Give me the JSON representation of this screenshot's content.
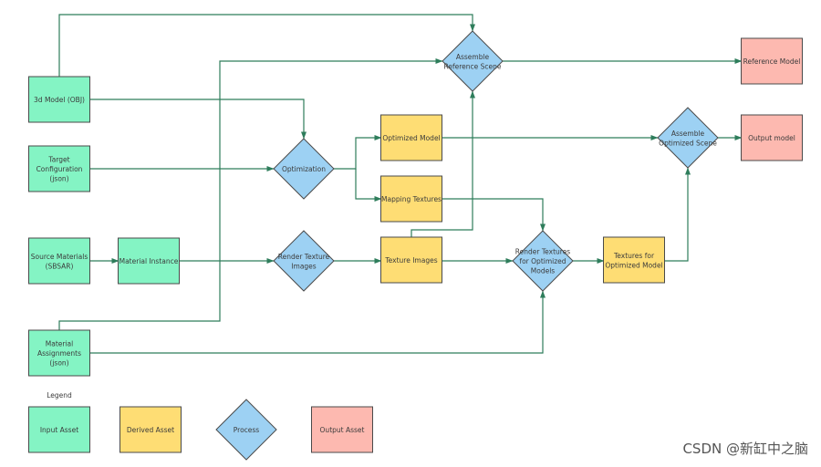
{
  "colors": {
    "input": "#84f4c4",
    "derived": "#fedd74",
    "process": "#9dd1f3",
    "output": "#fdb9b0",
    "edge": "#2e7d5b"
  },
  "nodes": {
    "model3d": [
      "3d Model (OBJ)"
    ],
    "target_config": [
      "Target",
      "Configuration",
      "(json)"
    ],
    "source_materials": [
      "Source Materials",
      "(SBSAR)"
    ],
    "material_instance": [
      "Material Instance"
    ],
    "material_assignments": [
      "Material",
      "Assignments",
      "(json)"
    ],
    "optimization": [
      "Optimization"
    ],
    "render_texture_images": [
      "Render Texture",
      "Images"
    ],
    "assemble_reference": [
      "Assemble",
      "Reference Scene"
    ],
    "optimized_model": [
      "Optimized Model"
    ],
    "mapping_textures": [
      "Mapping Textures"
    ],
    "texture_images": [
      "Texture Images"
    ],
    "render_textures_optimized": [
      "Render Textures",
      "for Optimized",
      "Models"
    ],
    "textures_optimized": [
      "Textures for",
      "Optimized Model"
    ],
    "assemble_optimized": [
      "Assemble",
      "Optimized Scene"
    ],
    "reference_model": [
      "Reference Model"
    ],
    "output_model": [
      "Output model"
    ]
  },
  "legend": {
    "title": "Legend",
    "input": "Input Asset",
    "derived": "Derived Asset",
    "process": "Process",
    "output": "Output Asset"
  },
  "watermark": "CSDN @新缸中之脑"
}
